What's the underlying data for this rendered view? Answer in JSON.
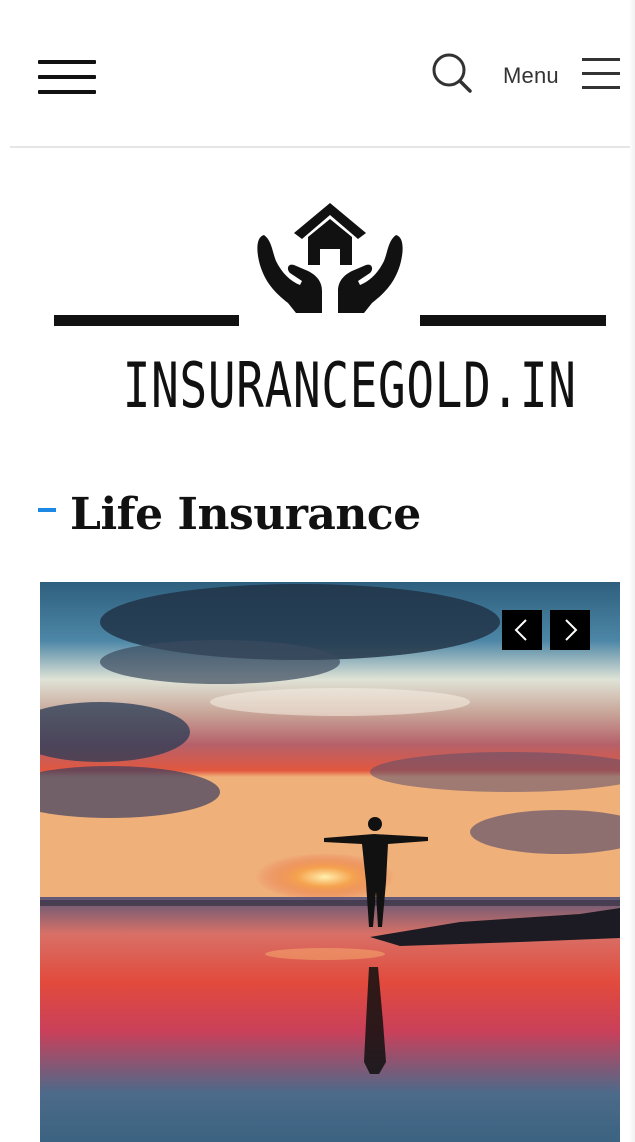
{
  "header": {
    "menu_label": "Menu",
    "icons": {
      "left_menu": "hamburger-icon",
      "search": "search-icon",
      "menu": "menu-icon"
    }
  },
  "logo": {
    "text": "INSURANCEGOLD.IN",
    "emblem": "house-in-hands-icon"
  },
  "section": {
    "title": "Life Insurance",
    "accent_color": "#1e88e5"
  },
  "slider": {
    "image_subject": "person-with-open-arms-at-sunset-beach",
    "prev_icon": "chevron-left-icon",
    "next_icon": "chevron-right-icon"
  }
}
